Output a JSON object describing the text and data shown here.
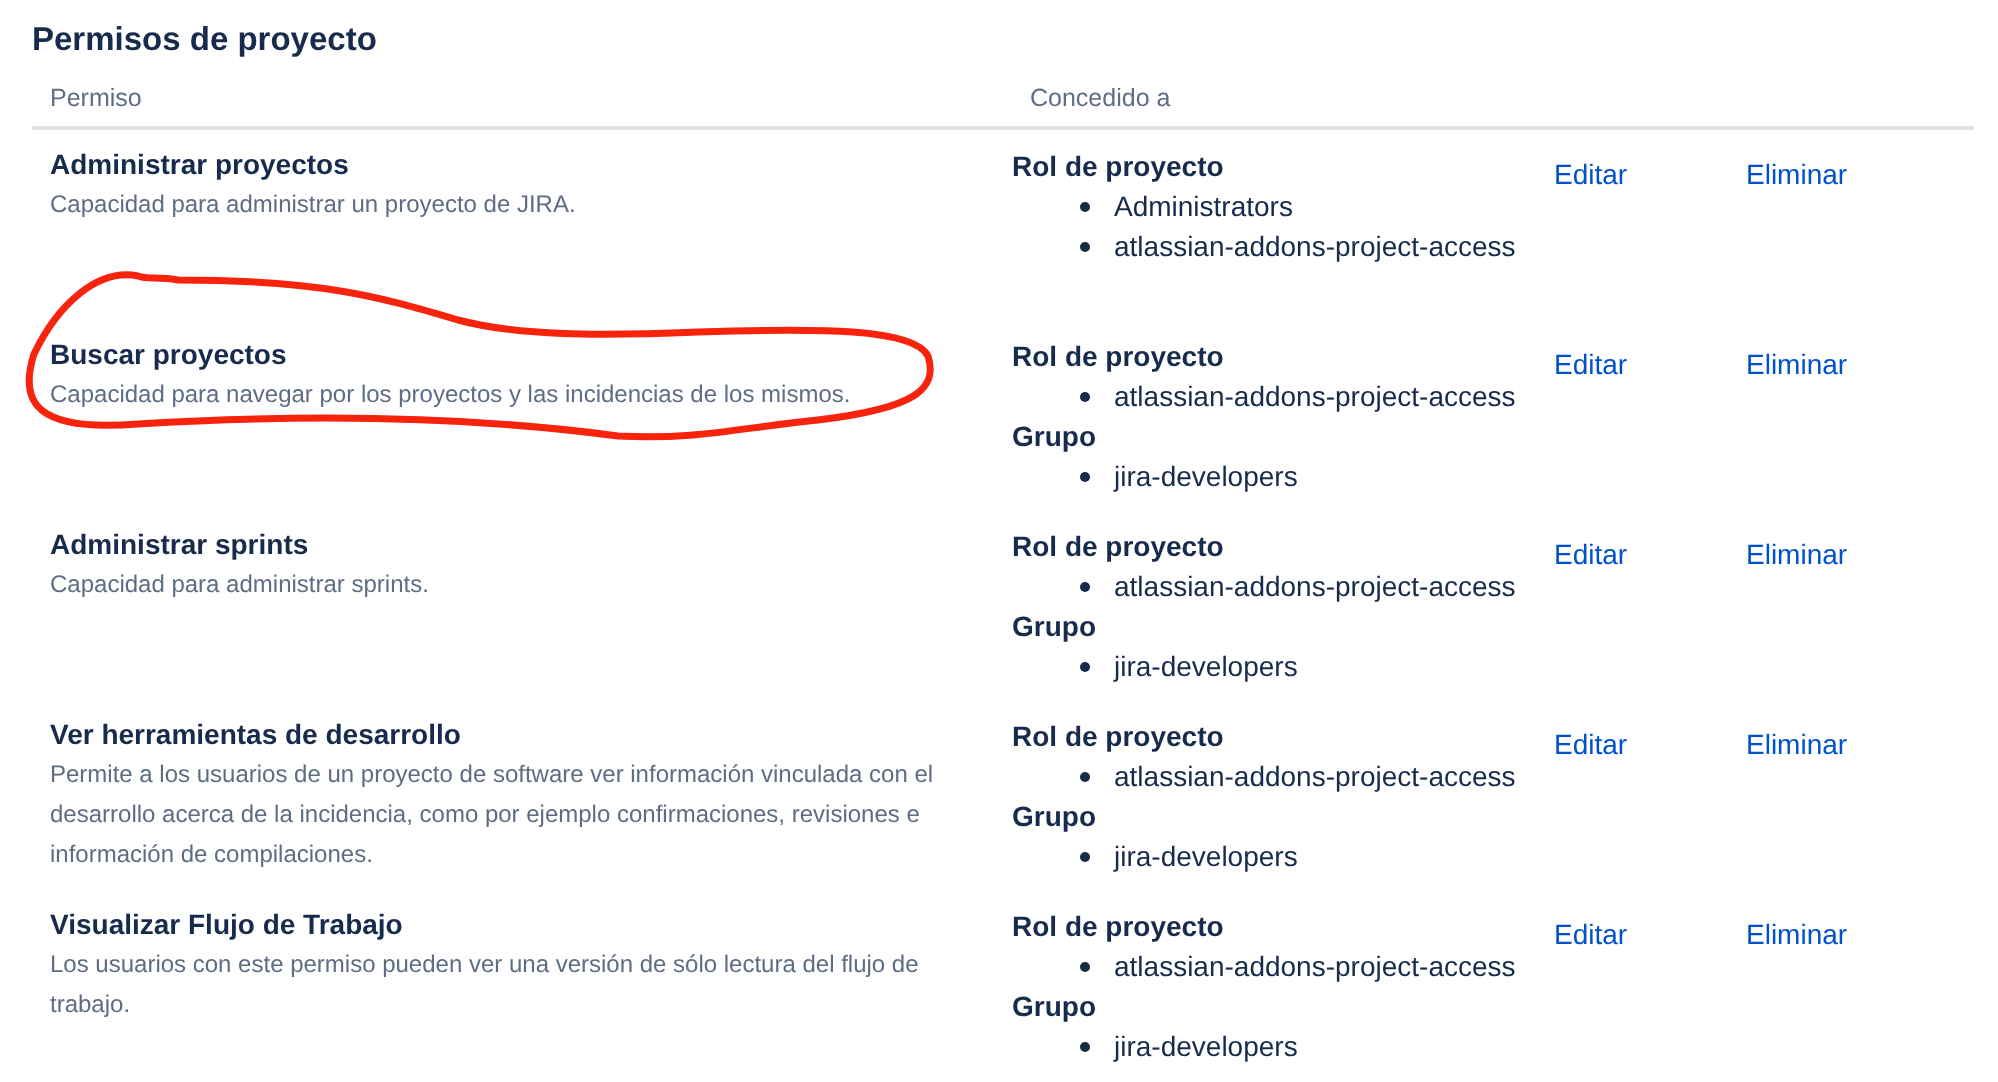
{
  "title": "Permisos de proyecto",
  "columns": [
    "Permiso",
    "Concedido a"
  ],
  "permissions": [
    {
      "name": "Administrar proyectos",
      "description": "Capacidad para administrar un proyecto de JIRA.",
      "circled": false,
      "grants": [
        {
          "label": "Rol de proyecto",
          "items": [
            "Administrators",
            "atlassian-addons-project-access"
          ]
        }
      ],
      "actions": [
        "Editar",
        "Eliminar"
      ]
    },
    {
      "name": "Buscar proyectos",
      "description": "Capacidad para navegar por los proyectos y las incidencias de los mismos.",
      "circled": true,
      "grants": [
        {
          "label": "Rol de proyecto",
          "items": [
            "atlassian-addons-project-access"
          ]
        },
        {
          "label": "Grupo",
          "items": [
            "jira-developers"
          ]
        }
      ],
      "actions": [
        "Editar",
        "Eliminar"
      ]
    },
    {
      "name": "Administrar sprints",
      "description": "Capacidad para administrar sprints.",
      "circled": false,
      "grants": [
        {
          "label": "Rol de proyecto",
          "items": [
            "atlassian-addons-project-access"
          ]
        },
        {
          "label": "Grupo",
          "items": [
            "jira-developers"
          ]
        }
      ],
      "actions": [
        "Editar",
        "Eliminar"
      ]
    },
    {
      "name": "Ver herramientas de desarrollo",
      "description": "Permite a los usuarios de un proyecto de software ver información vinculada con el desarrollo acerca de la incidencia, como por ejemplo confirmaciones, revisiones e información de compilaciones.",
      "circled": false,
      "grants": [
        {
          "label": "Rol de proyecto",
          "items": [
            "atlassian-addons-project-access"
          ]
        },
        {
          "label": "Grupo",
          "items": [
            "jira-developers"
          ]
        }
      ],
      "actions": [
        "Editar",
        "Eliminar"
      ]
    },
    {
      "name": "Visualizar Flujo de Trabajo",
      "description": "Los usuarios con este permiso pueden ver una versión de sólo lectura del flujo de trabajo.",
      "circled": false,
      "grants": [
        {
          "label": "Rol de proyecto",
          "items": [
            "atlassian-addons-project-access"
          ]
        },
        {
          "label": "Grupo",
          "items": [
            "jira-developers"
          ]
        }
      ],
      "actions": [
        "Editar",
        "Eliminar"
      ]
    }
  ]
}
